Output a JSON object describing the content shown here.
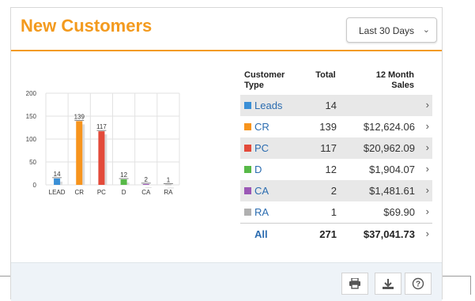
{
  "header": {
    "title": "New Customers",
    "range_select": "Last 30 Days"
  },
  "chart_data": {
    "type": "bar",
    "categories": [
      "LEAD",
      "CR",
      "PC",
      "D",
      "CA",
      "RA"
    ],
    "values": [
      14,
      139,
      117,
      12,
      2,
      1
    ],
    "colors": [
      "#3a8fd6",
      "#f7941d",
      "#e34a3a",
      "#57b947",
      "#9b59b6",
      "#b0b0b0"
    ],
    "ylim": [
      0,
      200
    ],
    "yticks": [
      0,
      50,
      100,
      150,
      200
    ],
    "grid": true,
    "legend": "none"
  },
  "table": {
    "headers": {
      "type": "Customer Type",
      "total": "Total",
      "sales": "12 Month Sales"
    },
    "rows": [
      {
        "type": "Leads",
        "total": "14",
        "sales": "",
        "color": "#3a8fd6"
      },
      {
        "type": "CR",
        "total": "139",
        "sales": "$12,624.06",
        "color": "#f7941d"
      },
      {
        "type": "PC",
        "total": "117",
        "sales": "$20,962.09",
        "color": "#e34a3a"
      },
      {
        "type": "D",
        "total": "12",
        "sales": "$1,904.07",
        "color": "#57b947"
      },
      {
        "type": "CA",
        "total": "2",
        "sales": "$1,481.61",
        "color": "#9b59b6"
      },
      {
        "type": "RA",
        "total": "1",
        "sales": "$69.90",
        "color": "#b0b0b0"
      }
    ],
    "all": {
      "type": "All",
      "total": "271",
      "sales": "$37,041.73"
    }
  },
  "footer": {
    "icons": [
      "print-icon",
      "download-icon",
      "help-icon"
    ]
  }
}
